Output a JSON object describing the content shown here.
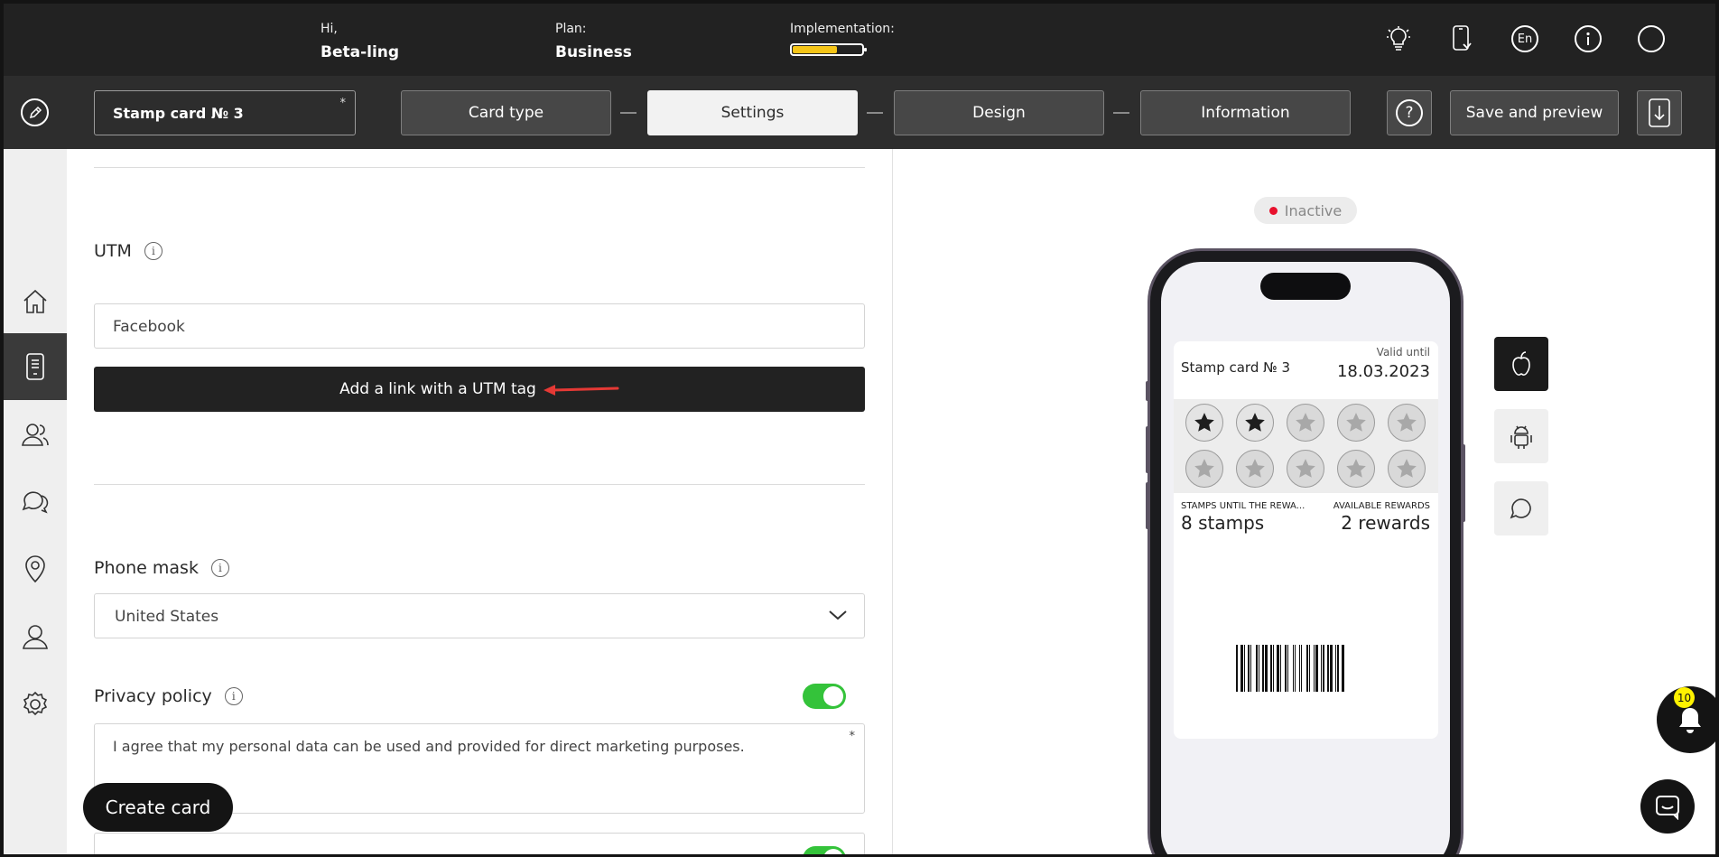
{
  "header": {
    "greeting_label": "Hi,",
    "user_name": "Beta-ling",
    "plan_label": "Plan:",
    "plan_value": "Business",
    "implementation_label": "Implementation:",
    "implementation_progress_percent": 65,
    "language": "En",
    "icons": [
      "lightbulb-icon",
      "phone-icon",
      "language-icon",
      "info-icon",
      "profile-icon"
    ]
  },
  "toolbar": {
    "card_name": "Stamp card № 3",
    "card_name_required_mark": "*",
    "steps": [
      "Card type",
      "Settings",
      "Design",
      "Information"
    ],
    "active_step": "Settings",
    "help_label": "?",
    "save_label": "Save and preview"
  },
  "sidebar": {
    "items": [
      "home",
      "cards",
      "clients",
      "messages",
      "locations",
      "users",
      "settings"
    ],
    "active": "cards"
  },
  "form": {
    "utm": {
      "label": "UTM",
      "value": "Facebook",
      "button_label": "Add a link with a UTM tag"
    },
    "phone_mask": {
      "label": "Phone mask",
      "selected": "United States"
    },
    "privacy": {
      "label": "Privacy policy",
      "enabled": true,
      "text": "I agree that my personal data can be used and provided for direct marketing purposes.",
      "required_mark": "*"
    },
    "create_button": "Create card"
  },
  "preview": {
    "status": "Inactive",
    "status_color": "#e8112d",
    "card": {
      "title": "Stamp card № 3",
      "valid_label": "Valid until",
      "valid_value": "18.03.2023",
      "stamps_total": 10,
      "stamps_filled": 2,
      "stamps_until_label": "STAMPS UNTIL THE REWA...",
      "stamps_until_value": "8 stamps",
      "rewards_label": "AVAILABLE REWARDS",
      "rewards_value": "2 rewards"
    },
    "platforms": [
      "apple-icon",
      "android-icon",
      "chat-bubble-icon"
    ],
    "active_platform": "apple"
  },
  "notifications": {
    "count": "10"
  },
  "colors": {
    "header_bg": "#222222",
    "toolbar_bg": "#2d2d2d",
    "toggle_on": "#34c33a",
    "progress": "#f5c518",
    "badge": "#fff200"
  }
}
